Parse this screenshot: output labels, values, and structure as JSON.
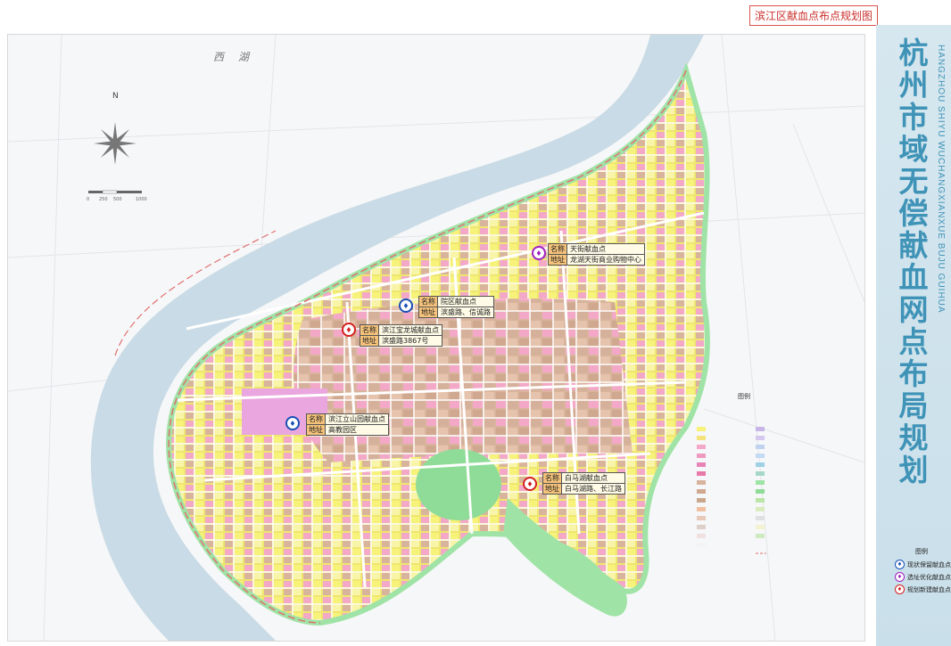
{
  "header": {
    "title": "滨江区献血点布点规划图"
  },
  "side_title": {
    "cn": "杭州市域无偿献血网点布局规划",
    "en": "HANGZHOU SHIYU WUCHANGXIANXUE BUJU GUIHUA"
  },
  "map": {
    "lake_label": "西 湖",
    "north_label": "N",
    "scale_labels": [
      "0",
      "250",
      "500",
      "1000"
    ],
    "map_legend_title": "图例",
    "sites": [
      {
        "name_key": "名称",
        "name": "天街献血点",
        "addr_key": "地址",
        "addr": "龙湖天街商业购物中心",
        "type": "optimize"
      },
      {
        "name_key": "名称",
        "name": "院区献血点",
        "addr_key": "地址",
        "addr": "滨盛路、信诚路",
        "type": "existing"
      },
      {
        "name_key": "名称",
        "name": "滨江宝龙城献血点",
        "addr_key": "地址",
        "addr": "滨盛路3867号",
        "type": "new"
      },
      {
        "name_key": "名称",
        "name": "滨江立山园献血点",
        "addr_key": "地址",
        "addr": "高教园区",
        "type": "existing"
      },
      {
        "name_key": "名称",
        "name": "白马湖献血点",
        "addr_key": "地址",
        "addr": "白马湖路、长江路",
        "type": "new"
      }
    ]
  },
  "legend": {
    "title": "图例",
    "items": [
      {
        "label": "现状保留献血点",
        "color": "#1a4fb5"
      },
      {
        "label": "选址优化献血点",
        "color": "#a020c0"
      },
      {
        "label": "规划新建献血点",
        "color": "#d42020"
      }
    ]
  },
  "colors": {
    "river": "#c9dbe6",
    "residential": "#f6f27a",
    "commercial": "#f09ac0",
    "green": "#9fe3a6",
    "industry": "#c9a88e",
    "boundary": "#e07070"
  }
}
